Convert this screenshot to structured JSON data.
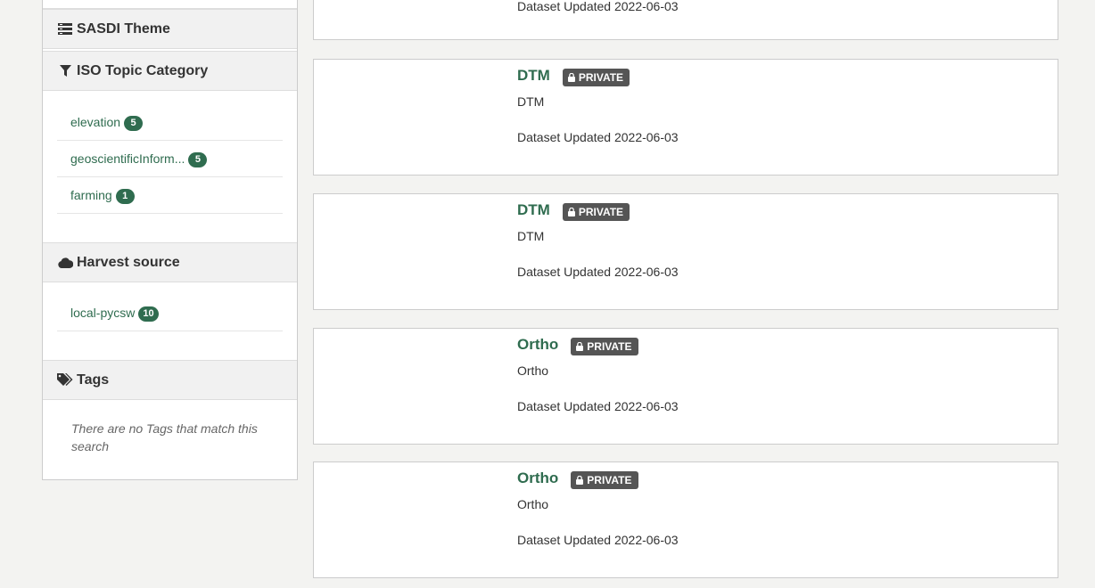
{
  "sidebar": {
    "sections": {
      "sasdi_theme": {
        "title": "SASDI Theme",
        "icon": "list-icon"
      },
      "iso_topic": {
        "title": "ISO Topic Category",
        "icon": "filter-icon",
        "items": [
          {
            "label": "elevation",
            "count": "5"
          },
          {
            "label": "geoscientificInform...",
            "count": "5"
          },
          {
            "label": "farming",
            "count": "1"
          }
        ]
      },
      "harvest_source": {
        "title": "Harvest source",
        "icon": "cloud-icon",
        "items": [
          {
            "label": "local-pycsw",
            "count": "10"
          }
        ]
      },
      "tags": {
        "title": "Tags",
        "icon": "tags-icon",
        "empty_text": "There are no Tags that match this search"
      }
    }
  },
  "datasets": {
    "top_partial": {
      "updated": "Dataset Updated 2022-06-03"
    },
    "items": [
      {
        "title": "DTM",
        "badge": "PRIVATE",
        "description": "DTM",
        "updated": "Dataset Updated 2022-06-03"
      },
      {
        "title": "DTM",
        "badge": "PRIVATE",
        "description": "DTM",
        "updated": "Dataset Updated 2022-06-03"
      },
      {
        "title": "Ortho",
        "badge": "PRIVATE",
        "description": "Ortho",
        "updated": "Dataset Updated 2022-06-03"
      },
      {
        "title": "Ortho",
        "badge": "PRIVATE",
        "description": "Ortho",
        "updated": "Dataset Updated 2022-06-03"
      }
    ]
  },
  "colors": {
    "accent": "#2f6c4f",
    "badge_bg": "#555555",
    "page_bg": "#f3f3f1"
  }
}
